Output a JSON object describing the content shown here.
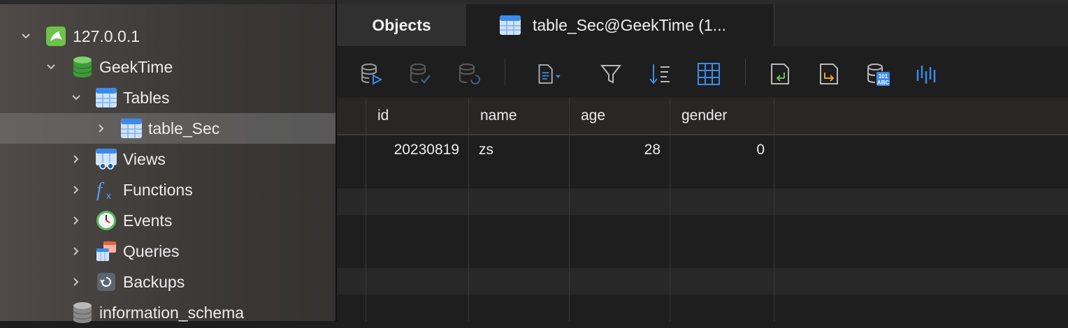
{
  "sidebar": {
    "connection": "127.0.0.1",
    "database": "GeekTime",
    "tables": "Tables",
    "table_item": "table_Sec",
    "views": "Views",
    "functions": "Functions",
    "events": "Events",
    "queries": "Queries",
    "backups": "Backups",
    "other_db": "information_schema"
  },
  "tabs": {
    "objects": "Objects",
    "table": "table_Sec@GeekTime (1..."
  },
  "toolbar": {
    "icons": [
      "db-run-icon",
      "db-commit-icon",
      "db-refresh-icon",
      "document-menu-icon",
      "filter-icon",
      "sort-icon",
      "grid-icon",
      "import-icon",
      "export-icon",
      "data-type-icon",
      "chart-icon"
    ]
  },
  "grid": {
    "columns": [
      "id",
      "name",
      "age",
      "gender"
    ],
    "rows": [
      {
        "id": "20230819",
        "name": "zs",
        "age": "28",
        "gender": "0"
      }
    ]
  },
  "colors": {
    "accent": "#3b8beb",
    "green": "#6cc24a",
    "orange": "#f0a030",
    "table_icon": "#4a90e2"
  }
}
